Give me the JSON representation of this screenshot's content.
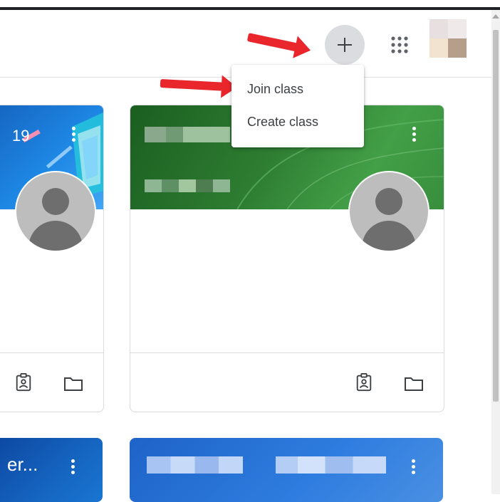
{
  "header": {
    "add_icon": "plus-icon",
    "apps_icon": "apps-grid-icon",
    "avatar_icon": "account-avatar"
  },
  "menu": {
    "items": [
      {
        "label": "Join class"
      },
      {
        "label": "Create class"
      }
    ]
  },
  "cards": [
    {
      "title": "19",
      "banner_color": "#1e88e5",
      "footer_icons": [
        "assignment-icon",
        "folder-icon"
      ]
    },
    {
      "title": "",
      "banner_color": "#2e7d32",
      "footer_icons": [
        "assignment-icon",
        "folder-icon"
      ]
    },
    {
      "title": "er...",
      "banner_color": "#1565c0"
    },
    {
      "title": "",
      "banner_color": "#2f7de0"
    }
  ],
  "colors": {
    "add_button_bg": "#dadce0",
    "annotation_arrow": "#e8262b",
    "card_border": "#dadce0"
  }
}
